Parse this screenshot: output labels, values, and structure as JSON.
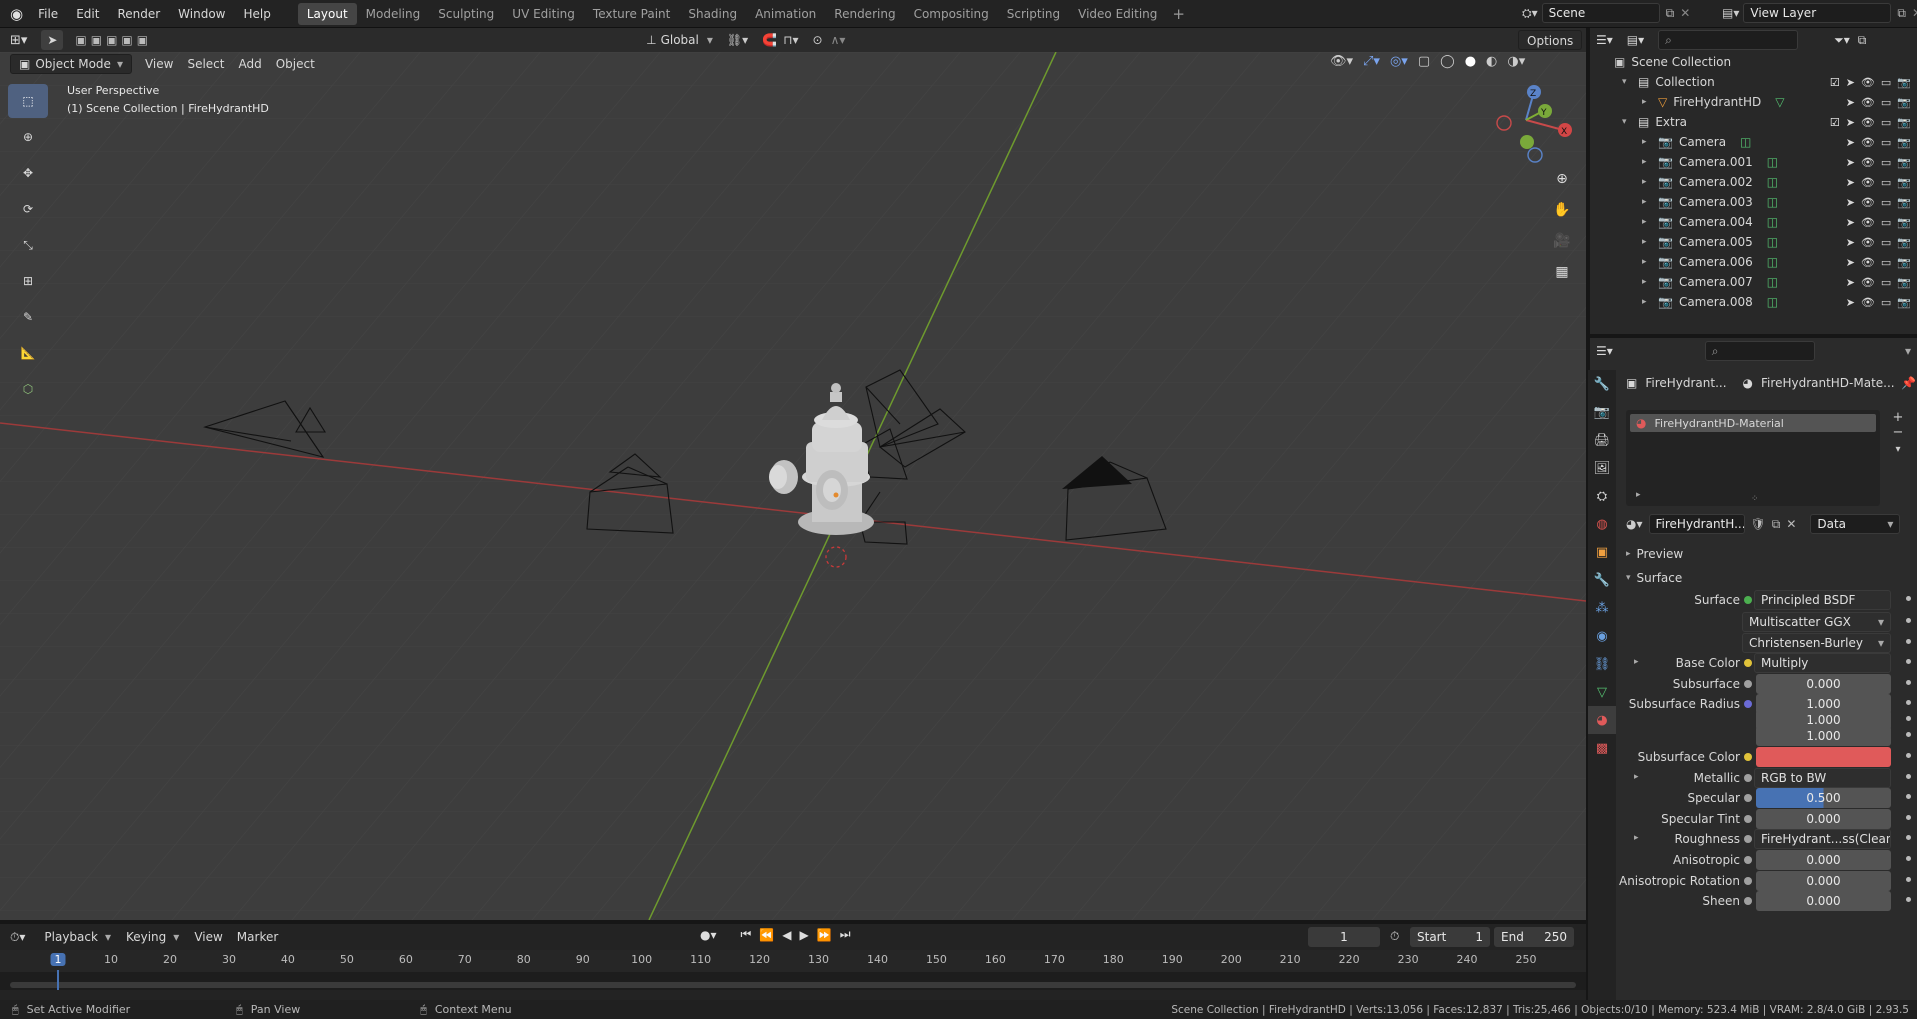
{
  "top_menu": [
    "File",
    "Edit",
    "Render",
    "Window",
    "Help"
  ],
  "workspaces": [
    {
      "label": "Layout",
      "active": true
    },
    {
      "label": "Modeling",
      "active": false
    },
    {
      "label": "Sculpting",
      "active": false
    },
    {
      "label": "UV Editing",
      "active": false
    },
    {
      "label": "Texture Paint",
      "active": false
    },
    {
      "label": "Shading",
      "active": false
    },
    {
      "label": "Animation",
      "active": false
    },
    {
      "label": "Rendering",
      "active": false
    },
    {
      "label": "Compositing",
      "active": false
    },
    {
      "label": "Scripting",
      "active": false
    },
    {
      "label": "Video Editing",
      "active": false
    }
  ],
  "scene": {
    "name": "Scene",
    "view_layer": "View Layer"
  },
  "viewport_header": {
    "mode": "Object Mode",
    "menus": [
      "View",
      "Select",
      "Add",
      "Object"
    ],
    "transform": "Global",
    "options": "Options"
  },
  "viewport": {
    "perspective": "User Perspective",
    "collection_info": "(1) Scene Collection | FireHydrantHD",
    "axis_labels": {
      "x": "X",
      "y": "Y",
      "z": "Z"
    }
  },
  "outliner": {
    "root": "Scene Collection",
    "rows": [
      {
        "label": "Collection",
        "depth": 1,
        "type": "collection"
      },
      {
        "label": "FireHydrantHD",
        "depth": 2,
        "type": "mesh"
      },
      {
        "label": "Extra",
        "depth": 1,
        "type": "collection"
      },
      {
        "label": "Camera",
        "depth": 2,
        "type": "camera"
      },
      {
        "label": "Camera.001",
        "depth": 2,
        "type": "camera"
      },
      {
        "label": "Camera.002",
        "depth": 2,
        "type": "camera"
      },
      {
        "label": "Camera.003",
        "depth": 2,
        "type": "camera"
      },
      {
        "label": "Camera.004",
        "depth": 2,
        "type": "camera"
      },
      {
        "label": "Camera.005",
        "depth": 2,
        "type": "camera"
      },
      {
        "label": "Camera.006",
        "depth": 2,
        "type": "camera"
      },
      {
        "label": "Camera.007",
        "depth": 2,
        "type": "camera"
      },
      {
        "label": "Camera.008",
        "depth": 2,
        "type": "camera"
      }
    ]
  },
  "properties": {
    "breadcrumb_object": "FireHydrant...",
    "breadcrumb_material": "FireHydrantHD-Mate...",
    "material_slot": "FireHydrantHD-Material",
    "material_name": "FireHydrantH...",
    "link": "Data",
    "preview": "Preview",
    "surface_panel": "Surface",
    "rows": [
      {
        "label": "Surface",
        "kind": "link",
        "value": "Principled BSDF",
        "dot": "#4caf50"
      },
      {
        "label": "",
        "kind": "dropdown",
        "value": "Multiscatter GGX"
      },
      {
        "label": "",
        "kind": "dropdown",
        "value": "Christensen-Burley"
      },
      {
        "label": "Base Color",
        "kind": "link",
        "value": "Multiply",
        "dot": "#e0c23a",
        "expand": true
      },
      {
        "label": "Subsurface",
        "kind": "value",
        "value": "0.000",
        "dot": "#a0a0a0"
      },
      {
        "label": "Subsurface Radius",
        "kind": "value",
        "value": "1.000",
        "dot": "#6b6bd6"
      },
      {
        "label": "",
        "kind": "value",
        "value": "1.000"
      },
      {
        "label": "",
        "kind": "value",
        "value": "1.000"
      },
      {
        "label": "Subsurface Color",
        "kind": "color",
        "value": "",
        "dot": "#e0c23a",
        "color": "#e05a5a"
      },
      {
        "label": "Metallic",
        "kind": "link",
        "value": "RGB to BW",
        "dot": "#a0a0a0",
        "expand": true
      },
      {
        "label": "Specular",
        "kind": "slider",
        "value": "0.500",
        "dot": "#a0a0a0",
        "fill": 0.5
      },
      {
        "label": "Specular Tint",
        "kind": "value",
        "value": "0.000",
        "dot": "#a0a0a0"
      },
      {
        "label": "Roughness",
        "kind": "link",
        "value": "FireHydrant...ss(Clean).png",
        "dot": "#a0a0a0",
        "expand": true
      },
      {
        "label": "Anisotropic",
        "kind": "value",
        "value": "0.000",
        "dot": "#a0a0a0"
      },
      {
        "label": "Anisotropic Rotation",
        "kind": "value",
        "value": "0.000",
        "dot": "#a0a0a0"
      },
      {
        "label": "Sheen",
        "kind": "value",
        "value": "0.000",
        "dot": "#a0a0a0"
      }
    ]
  },
  "timeline": {
    "menus": [
      "Playback",
      "Keying",
      "View",
      "Marker"
    ],
    "current_frame": "1",
    "start_label": "Start",
    "start": "1",
    "end_label": "End",
    "end": "250",
    "ticks": [
      "1",
      "10",
      "20",
      "30",
      "40",
      "50",
      "60",
      "70",
      "80",
      "90",
      "100",
      "110",
      "120",
      "130",
      "140",
      "150",
      "160",
      "170",
      "180",
      "190",
      "200",
      "210",
      "220",
      "230",
      "240",
      "250"
    ],
    "ticks_start": 1,
    "ticks_end": 250,
    "current": 1
  },
  "status": {
    "left1": "Set Active Modifier",
    "left2": "Pan View",
    "left3": "Context Menu",
    "stats": "Scene Collection | FireHydrantHD | Verts:13,056 | Faces:12,837 | Tris:25,466 | Objects:0/10 | Memory: 523.4 MiB | VRAM: 2.8/4.0 GiB | 2.93.5"
  }
}
